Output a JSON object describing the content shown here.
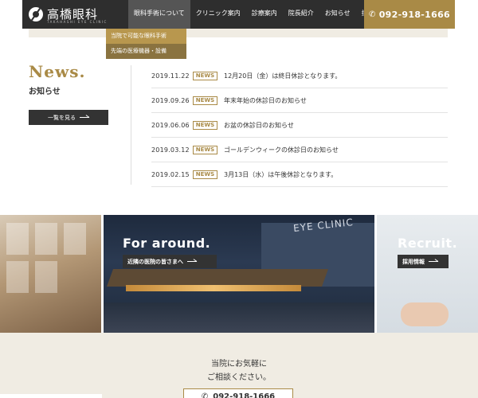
{
  "header": {
    "logo_text": "高橋眼科",
    "logo_sub": "TAKAHASHI EYE CLINIC",
    "nav": [
      {
        "label": "眼科手術について",
        "active": true
      },
      {
        "label": "クリニック案内",
        "active": false
      },
      {
        "label": "診療案内",
        "active": false
      },
      {
        "label": "院長紹介",
        "active": false
      },
      {
        "label": "お知らせ",
        "active": false
      },
      {
        "label": "採用情報",
        "active": false
      }
    ],
    "phone": "092-918-1666",
    "dropdown": [
      "当院で可能な眼科手術",
      "先端の医療機器・設備"
    ]
  },
  "news": {
    "title": "News.",
    "subtitle": "お知らせ",
    "button_label": "一覧を見る",
    "badge": "NEWS",
    "items": [
      {
        "date": "2019.11.22",
        "text": "12月20日（金）は終日休診となります。"
      },
      {
        "date": "2019.09.26",
        "text": "年末年始の休診日のお知らせ"
      },
      {
        "date": "2019.06.06",
        "text": "お盆の休診日のお知らせ"
      },
      {
        "date": "2019.03.12",
        "text": "ゴールデンウィークの休診日のお知らせ"
      },
      {
        "date": "2019.02.15",
        "text": "3月13日（水）は午後休診となります。"
      }
    ]
  },
  "banner": {
    "sign_text": "EYE CLINIC",
    "left_heading": "For around.",
    "left_button": "近隣の医院の皆さまへ",
    "right_heading": "Recruit.",
    "right_button": "採用情報"
  },
  "contact": {
    "line1": "当院にお気軽に",
    "line2": "ご相談ください。",
    "phone": "092-918-1666"
  },
  "colors": {
    "accent": "#a98a46",
    "dark": "#2e2e2e",
    "cream": "#f0ece3"
  }
}
